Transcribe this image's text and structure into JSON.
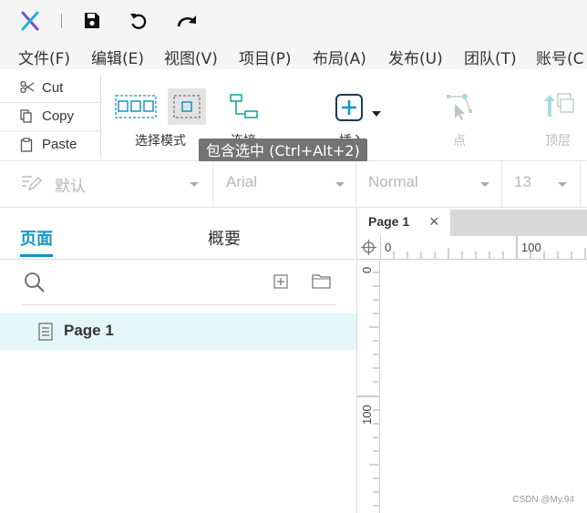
{
  "titlebar": {
    "icons": [
      "logo-icon",
      "save-icon",
      "undo-icon",
      "redo-icon"
    ]
  },
  "menu": {
    "items": [
      "文件(F)",
      "编辑(E)",
      "视图(V)",
      "项目(P)",
      "布局(A)",
      "发布(U)",
      "团队(T)",
      "账号(C"
    ]
  },
  "toolbar": {
    "cut_label": "Cut",
    "copy_label": "Copy",
    "paste_label": "Paste",
    "select_mode_label": "选择模式",
    "connect_label": "连接",
    "insert_label": "插入",
    "point_label": "点",
    "top_label": "顶层"
  },
  "tooltip": {
    "text": "包含选中 (Ctrl+Alt+2)"
  },
  "stylebar": {
    "style_value": "默认",
    "font_value": "Arial",
    "weight_value": "Normal",
    "size_value": "13"
  },
  "leftpanel": {
    "tab_pages": "页面",
    "tab_outline": "概要",
    "page_item": "Page 1"
  },
  "canvas": {
    "tab_label": "Page 1",
    "close_glyph": "×",
    "hruler_0": "0",
    "hruler_100": "100",
    "vruler_0": "0",
    "vruler_100": "100"
  },
  "watermark": "CSDN @My.94",
  "colors": {
    "accent": "#1496c8",
    "selected_row": "#e4f6f8",
    "tooltip_bg": "#737373"
  }
}
